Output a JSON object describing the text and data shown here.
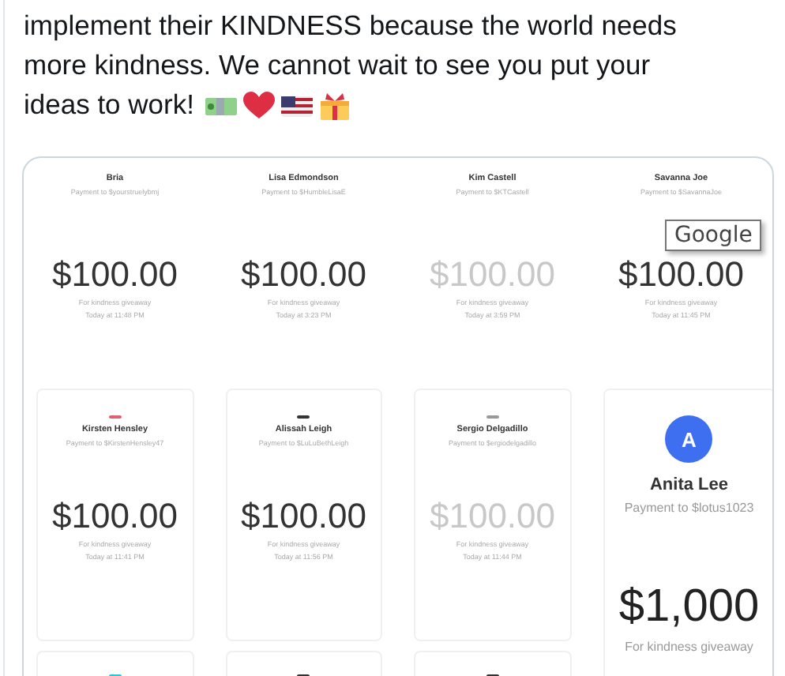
{
  "tweet": {
    "lines": [
      "implement their KINDNESS because the world needs",
      "more kindness. We cannot wait to see you put your",
      "ideas to work!"
    ]
  },
  "image": {
    "payments": [
      {
        "kind": "plain",
        "name": "Bria",
        "to": "Payment to $yourstruelybmj",
        "amount": "$100.00",
        "dimmed": false,
        "memo": "For kindness giveaway",
        "time": "Today at 11:48 PM"
      },
      {
        "kind": "plain",
        "name": "Lisa Edmondson",
        "to": "Payment to $HumbleLisaE",
        "amount": "$100.00",
        "dimmed": false,
        "memo": "For kindness giveaway",
        "time": "Today at 3:23 PM"
      },
      {
        "kind": "plain",
        "name": "Kim Castell",
        "to": "Payment to $KTCastell",
        "amount": "$100.00",
        "dimmed": true,
        "memo": "For kindness giveaway",
        "time": "Today at 3:59 PM"
      },
      {
        "kind": "plain",
        "name": "Savanna Joe",
        "to": "Payment to $SavannaJoe",
        "amount": "$100.00",
        "dimmed": false,
        "memo": "For kindness giveaway",
        "time": "Today at 11:45 PM"
      },
      {
        "kind": "card",
        "color": "#e06070",
        "name": "Kirsten Hensley",
        "to": "Payment to $KirstenHensley47",
        "amount": "$100.00",
        "dimmed": false,
        "memo": "For kindness giveaway",
        "time": "Today at 11:41 PM"
      },
      {
        "kind": "card",
        "color": "#333333",
        "name": "Alissah Leigh",
        "to": "Payment to $LuLuBethLeigh",
        "amount": "$100.00",
        "dimmed": false,
        "memo": "For kindness giveaway",
        "time": "Today at 11:56 PM"
      },
      {
        "kind": "card",
        "color": "#999999",
        "name": "Sergio Delgadillo",
        "to": "Payment to $ergiodelgadillo",
        "amount": "$100.00",
        "dimmed": true,
        "memo": "For kindness giveaway",
        "time": "Today at 11:44 PM"
      },
      {
        "kind": "featured",
        "color": "#3d6ff0",
        "initial": "A",
        "name": "Anita Lee",
        "to": "Payment to $lotus1023",
        "amount": "$1,000",
        "memo": "For kindness giveaway"
      },
      {
        "kind": "stub",
        "color": "#29c5e0"
      },
      {
        "kind": "stub",
        "color": "#333333"
      },
      {
        "kind": "stub",
        "color": "#333333"
      }
    ]
  },
  "tooltip": {
    "text": "Google"
  }
}
